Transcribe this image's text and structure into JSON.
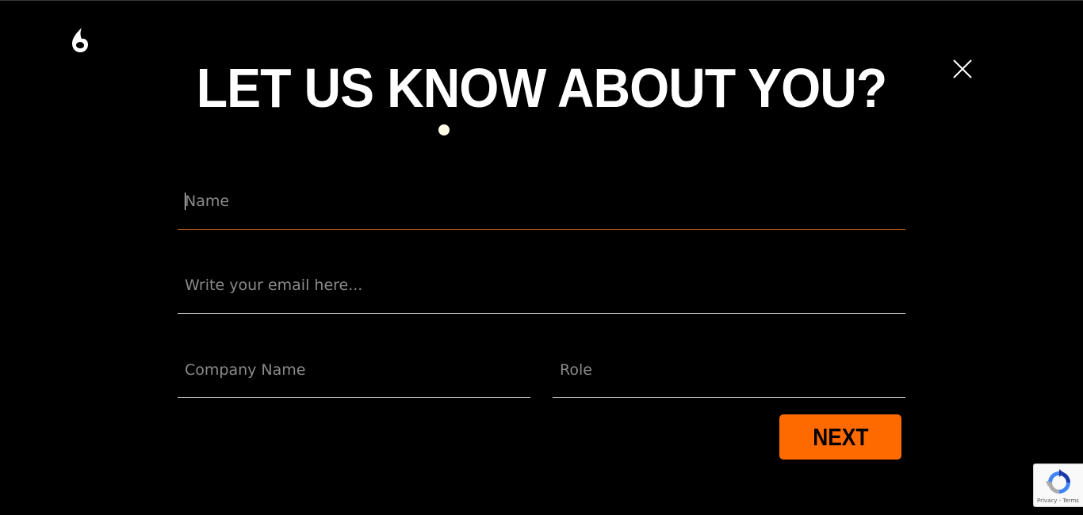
{
  "header": {
    "logo_icon": "flame-drop-icon",
    "title": "LET US KNOW ABOUT YOU?",
    "close_icon": "close-x-icon"
  },
  "form": {
    "name_placeholder": "Name",
    "email_placeholder": "Write your email here...",
    "company_placeholder": "Company Name",
    "role_placeholder": "Role",
    "next_label": "NEXT"
  },
  "recaptcha": {
    "icon": "recaptcha-icon",
    "privacy_label": "Privacy",
    "separator": " - ",
    "terms_label": "Terms"
  },
  "colors": {
    "background": "#000000",
    "accent": "#ff6a00",
    "active_underline": "#c2601e",
    "text": "#ffffff",
    "placeholder": "#8a8a8a"
  }
}
